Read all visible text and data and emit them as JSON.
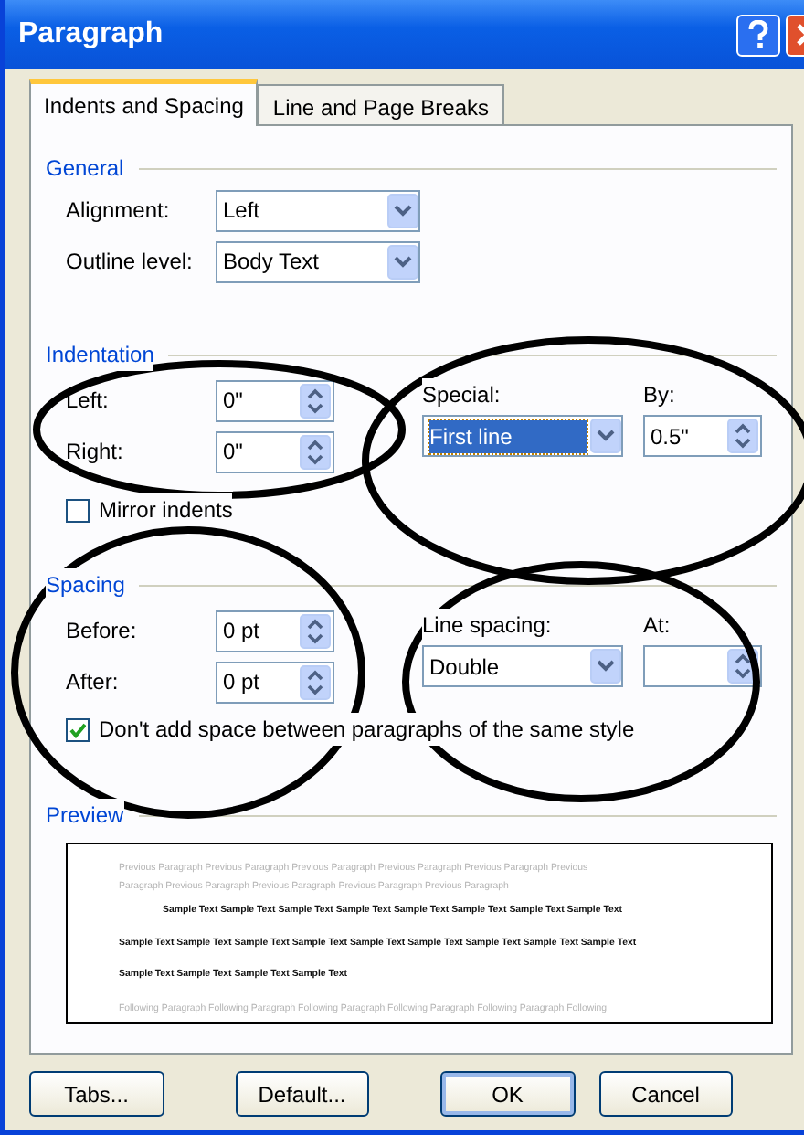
{
  "window": {
    "title": "Paragraph"
  },
  "tabs": [
    {
      "label": "Indents and Spacing",
      "selected": true
    },
    {
      "label": "Line and Page Breaks",
      "selected": false
    }
  ],
  "general": {
    "heading": "General",
    "fields": [
      {
        "label": "Alignment:",
        "value": "Left"
      },
      {
        "label": "Outline level:",
        "value": "Body Text"
      }
    ]
  },
  "indentation": {
    "heading": "Indentation",
    "left": {
      "label": "Left:",
      "value": "0\""
    },
    "right": {
      "label": "Right:",
      "value": "0\""
    },
    "special": {
      "label": "Special:",
      "value": "First line",
      "focused": true
    },
    "by": {
      "label": "By:",
      "value": "0.5\""
    },
    "mirror_indents": {
      "label": "Mirror indents",
      "checked": false
    }
  },
  "spacing": {
    "heading": "Spacing",
    "before": {
      "label": "Before:",
      "value": "0 pt"
    },
    "after": {
      "label": "After:",
      "value": "0 pt"
    },
    "line_spacing": {
      "label": "Line spacing:",
      "value": "Double",
      "focused": false
    },
    "at": {
      "label": "At:"
    },
    "dont_add_space": {
      "label": "Don't add space between paragraphs of the same style",
      "checked": true
    }
  },
  "preview": {
    "heading": "Preview",
    "previous_lines": [
      "Previous Paragraph Previous Paragraph Previous Paragraph Previous Paragraph Previous Paragraph Previous",
      "Paragraph Previous Paragraph Previous Paragraph Previous Paragraph Previous Paragraph"
    ],
    "sample_lines": [
      "Sample Text Sample Text Sample Text Sample Text Sample Text Sample Text Sample Text Sample Text",
      "Sample Text Sample Text Sample Text Sample Text Sample Text Sample Text Sample Text Sample Text Sample Text",
      "Sample Text Sample Text Sample Text Sample Text"
    ],
    "following_lines": [
      "Following Paragraph Following Paragraph Following Paragraph Following Paragraph Following Paragraph Following"
    ]
  },
  "buttons": [
    {
      "label": "Tabs...",
      "default": false
    },
    {
      "label": "Default...",
      "default": false
    },
    {
      "label": "OK",
      "default": true
    },
    {
      "label": "Cancel",
      "default": false
    }
  ]
}
